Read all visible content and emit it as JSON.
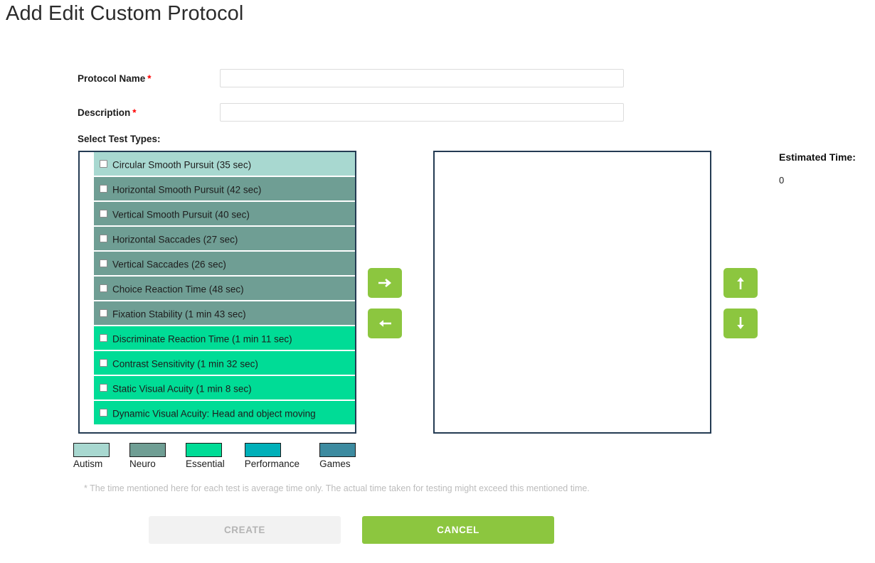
{
  "page": {
    "title": "Add Edit Custom Protocol"
  },
  "form": {
    "protocol_name": {
      "label": "Protocol Name",
      "required_marker": "*",
      "value": "",
      "placeholder": ""
    },
    "description": {
      "label": "Description",
      "required_marker": "*",
      "value": "",
      "placeholder": ""
    },
    "section_label": "Select Test Types:"
  },
  "available_tests": [
    {
      "name": "Circular Smooth Pursuit (35 sec)",
      "category": "Autism",
      "color": "#a8d8d0",
      "checked": false
    },
    {
      "name": "Horizontal Smooth Pursuit (42 sec)",
      "category": "Neuro",
      "color": "#6f9e94",
      "checked": false
    },
    {
      "name": "Vertical Smooth Pursuit (40 sec)",
      "category": "Neuro",
      "color": "#6f9e94",
      "checked": false
    },
    {
      "name": "Horizontal Saccades (27 sec)",
      "category": "Neuro",
      "color": "#6f9e94",
      "checked": false
    },
    {
      "name": "Vertical Saccades (26 sec)",
      "category": "Neuro",
      "color": "#6f9e94",
      "checked": false
    },
    {
      "name": "Choice Reaction Time (48 sec)",
      "category": "Neuro",
      "color": "#6f9e94",
      "checked": false
    },
    {
      "name": "Fixation Stability (1 min 43 sec)",
      "category": "Neuro",
      "color": "#6f9e94",
      "checked": false
    },
    {
      "name": "Discriminate Reaction Time (1 min 11 sec)",
      "category": "Essential",
      "color": "#00dc96",
      "checked": false
    },
    {
      "name": "Contrast Sensitivity (1 min 32 sec)",
      "category": "Essential",
      "color": "#00dc96",
      "checked": false
    },
    {
      "name": "Static Visual Acuity (1 min 8 sec)",
      "category": "Essential",
      "color": "#00dc96",
      "checked": false
    },
    {
      "name": "Dynamic Visual Acuity: Head and object moving",
      "category": "Essential",
      "color": "#00dc96",
      "checked": false
    }
  ],
  "selected_tests": [],
  "transfer_buttons": {
    "move_right": {
      "icon": "arrow-right-icon",
      "label": ""
    },
    "move_left": {
      "icon": "arrow-left-icon",
      "label": ""
    },
    "move_up": {
      "icon": "arrow-up-icon",
      "label": ""
    },
    "move_down": {
      "icon": "arrow-down-icon",
      "label": ""
    },
    "color": "#8cc63f"
  },
  "estimated_time": {
    "label": "Estimated Time:",
    "value": "0"
  },
  "legend": [
    {
      "label": "Autism",
      "color": "#a8d8d0"
    },
    {
      "label": "Neuro",
      "color": "#6f9e94"
    },
    {
      "label": "Essential",
      "color": "#00dc96"
    },
    {
      "label": "Performance",
      "color": "#00b0b9"
    },
    {
      "label": "Games",
      "color": "#3d8ba0"
    }
  ],
  "footnote": "* The time mentioned here for each test is average time only. The actual time taken for testing might exceed this mentioned time.",
  "actions": {
    "create": {
      "label": "CREATE",
      "disabled": true
    },
    "cancel": {
      "label": "CANCEL",
      "disabled": false
    }
  }
}
